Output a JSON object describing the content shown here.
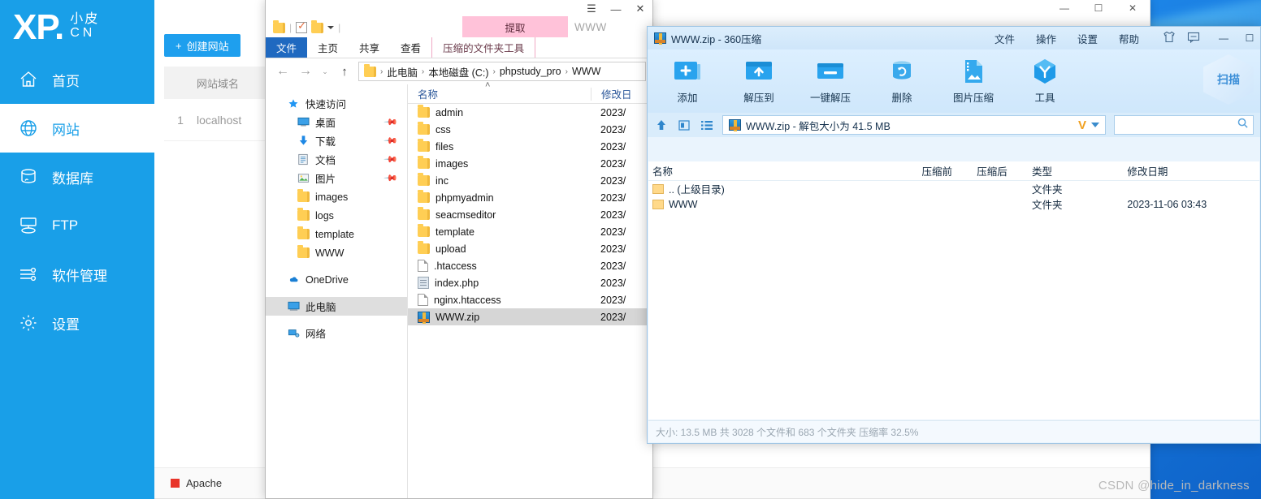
{
  "desktop": {
    "watermark": "CSDN @hide_in_darkness"
  },
  "phpstudy": {
    "titlebar": {
      "minimize": "—",
      "maximize": "☐",
      "close": "✕"
    },
    "logo": {
      "big": "XP.",
      "line1": "小皮",
      "line2": "CN"
    },
    "nav": [
      {
        "label": "首页",
        "icon": "home-icon",
        "active": false
      },
      {
        "label": "网站",
        "icon": "globe-icon",
        "active": true
      },
      {
        "label": "数据库",
        "icon": "database-icon",
        "active": false
      },
      {
        "label": "FTP",
        "icon": "ftp-icon",
        "active": false
      },
      {
        "label": "软件管理",
        "icon": "sliders-icon",
        "active": false
      },
      {
        "label": "设置",
        "icon": "gear-icon",
        "active": false
      }
    ],
    "create_button": "创建网站",
    "create_button_plus": "+",
    "table": {
      "headers": {
        "index": "",
        "domain": "网站域名"
      },
      "rows": [
        {
          "index": "1",
          "domain": "localhost"
        }
      ]
    },
    "status": {
      "service": "Apache",
      "dot_color": "#e8342a"
    }
  },
  "explorer": {
    "titlebar": {
      "menu": "☰",
      "minimize": "—",
      "close": "✕"
    },
    "quick_access_toolbar": {
      "folder_icon": "folder-icon",
      "properties_icon": "properties-icon",
      "new_folder_icon": "new-folder-icon",
      "dropdown_icon": "chevron-down-icon"
    },
    "ribbon": {
      "contextual_header": "提取",
      "window_label": "WWW",
      "tabs": [
        {
          "label": "文件",
          "kind": "file"
        },
        {
          "label": "主页",
          "kind": "normal"
        },
        {
          "label": "共享",
          "kind": "normal"
        },
        {
          "label": "查看",
          "kind": "normal"
        },
        {
          "label": "压缩的文件夹工具",
          "kind": "ctx"
        }
      ]
    },
    "nav": {
      "back": "←",
      "forward": "→",
      "history": "⌄",
      "up": "↑",
      "breadcrumb": [
        "此电脑",
        "本地磁盘 (C:)",
        "phpstudy_pro",
        "WWW"
      ],
      "separator": "›"
    },
    "nav_pane": [
      {
        "label": "快速访问",
        "icon": "star-icon",
        "level": 1,
        "pinned": false,
        "selected": false
      },
      {
        "label": "桌面",
        "icon": "desktop-icon",
        "level": 2,
        "pinned": true,
        "selected": false
      },
      {
        "label": "下载",
        "icon": "download-icon",
        "level": 2,
        "pinned": true,
        "selected": false
      },
      {
        "label": "文档",
        "icon": "documents-icon",
        "level": 2,
        "pinned": true,
        "selected": false
      },
      {
        "label": "图片",
        "icon": "pictures-icon",
        "level": 2,
        "pinned": true,
        "selected": false
      },
      {
        "label": "images",
        "icon": "folder-icon",
        "level": 2,
        "pinned": false,
        "selected": false
      },
      {
        "label": "logs",
        "icon": "folder-icon",
        "level": 2,
        "pinned": false,
        "selected": false
      },
      {
        "label": "template",
        "icon": "folder-icon",
        "level": 2,
        "pinned": false,
        "selected": false
      },
      {
        "label": "WWW",
        "icon": "folder-icon",
        "level": 2,
        "pinned": false,
        "selected": false
      },
      {
        "label": "OneDrive",
        "icon": "cloud-icon",
        "level": 1,
        "pinned": false,
        "selected": false
      },
      {
        "label": "此电脑",
        "icon": "pc-icon",
        "level": 1,
        "pinned": false,
        "selected": true
      },
      {
        "label": "网络",
        "icon": "network-icon",
        "level": 1,
        "pinned": false,
        "selected": false
      }
    ],
    "list": {
      "headers": {
        "name": "名称",
        "date": "修改日"
      },
      "sort_marker": "˄",
      "rows": [
        {
          "name": "admin",
          "date": "2023/",
          "icon": "folder-icon",
          "selected": false
        },
        {
          "name": "css",
          "date": "2023/",
          "icon": "folder-icon",
          "selected": false
        },
        {
          "name": "files",
          "date": "2023/",
          "icon": "folder-icon",
          "selected": false
        },
        {
          "name": "images",
          "date": "2023/",
          "icon": "folder-icon",
          "selected": false
        },
        {
          "name": "inc",
          "date": "2023/",
          "icon": "folder-icon",
          "selected": false
        },
        {
          "name": "phpmyadmin",
          "date": "2023/",
          "icon": "folder-icon",
          "selected": false
        },
        {
          "name": "seacmseditor",
          "date": "2023/",
          "icon": "folder-icon",
          "selected": false
        },
        {
          "name": "template",
          "date": "2023/",
          "icon": "folder-icon",
          "selected": false
        },
        {
          "name": "upload",
          "date": "2023/",
          "icon": "folder-icon",
          "selected": false
        },
        {
          "name": ".htaccess",
          "date": "2023/",
          "icon": "file-icon",
          "selected": false
        },
        {
          "name": "index.php",
          "date": "2023/",
          "icon": "php-file-icon",
          "selected": false
        },
        {
          "name": "nginx.htaccess",
          "date": "2023/",
          "icon": "file-icon",
          "selected": false
        },
        {
          "name": "WWW.zip",
          "date": "2023/",
          "icon": "zip-file-icon",
          "selected": true
        }
      ]
    }
  },
  "zipper": {
    "title": "WWW.zip - 360压缩",
    "title_icon": "zip-file-icon",
    "menus": [
      "文件",
      "操作",
      "设置",
      "帮助"
    ],
    "header_icons": [
      "skin-icon",
      "feedback-icon"
    ],
    "window_buttons": {
      "minimize": "—",
      "maximize": "☐"
    },
    "toolbar": [
      {
        "label": "添加",
        "icon": "add-archive-icon"
      },
      {
        "label": "解压到",
        "icon": "extract-to-icon"
      },
      {
        "label": "一键解压",
        "icon": "one-click-extract-icon"
      },
      {
        "label": "删除",
        "icon": "delete-icon"
      },
      {
        "label": "图片压缩",
        "icon": "image-compress-icon"
      },
      {
        "label": "工具",
        "icon": "tools-icon"
      }
    ],
    "scan_badge": "扫描",
    "pathbar": {
      "up_icon": "up-arrow-icon",
      "view_icon": "view-thumbnails-icon",
      "list_icon": "view-list-icon",
      "path_text": "WWW.zip - 解包大小为 41.5 MB",
      "path_icon": "zip-file-icon",
      "antivirus_mark": "V",
      "dropdown_icon": "chevron-down-icon",
      "search_icon": "search-icon",
      "search_value": "",
      "search_placeholder": ""
    },
    "list": {
      "headers": {
        "name": "名称",
        "before": "压缩前",
        "after": "压缩后",
        "type": "类型",
        "date": "修改日期"
      },
      "rows": [
        {
          "name": ".. (上级目录)",
          "before": "",
          "after": "",
          "type": "文件夹",
          "date": "",
          "icon": "folder-icon"
        },
        {
          "name": "WWW",
          "before": "",
          "after": "",
          "type": "文件夹",
          "date": "2023-11-06 03:43",
          "icon": "folder-icon"
        }
      ]
    },
    "status": "大小: 13.5 MB 共 3028 个文件和 683 个文件夹 压缩率 32.5%"
  },
  "colors": {
    "brand_blue": "#199fe8",
    "ribbon_file_blue": "#1f69c0",
    "contextual_pink": "#ffc2d9",
    "zip_window_blue": "#cfe6fa",
    "status_red": "#e8342a"
  }
}
